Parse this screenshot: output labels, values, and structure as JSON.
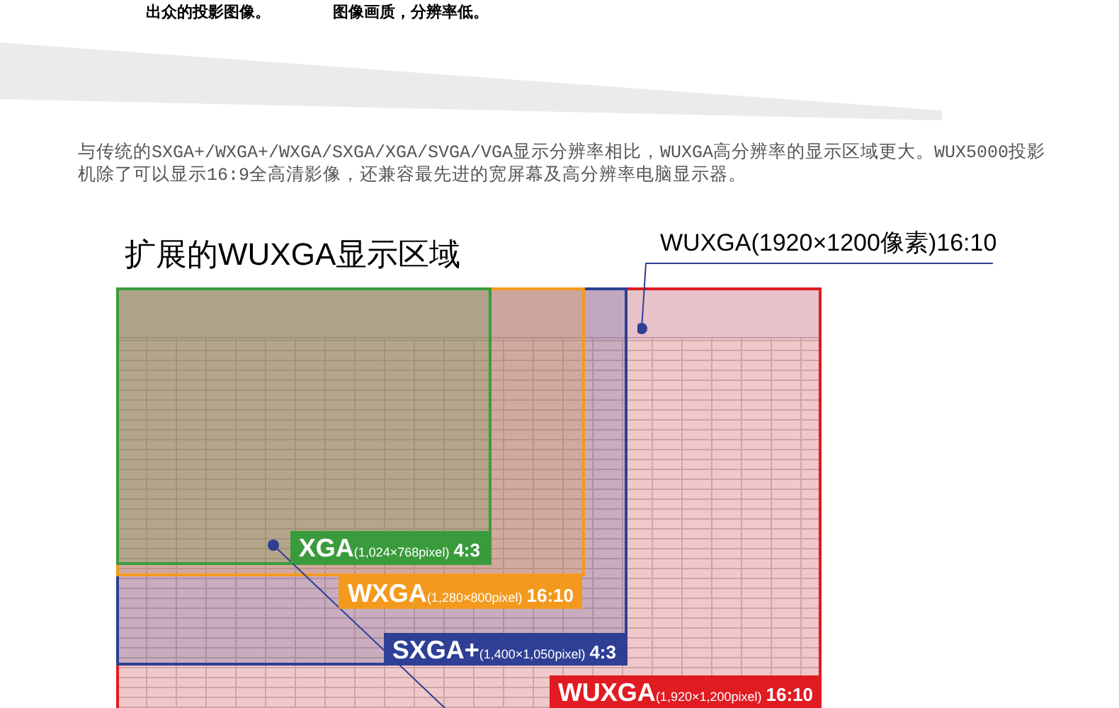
{
  "top_captions": [
    "出众的投影图像。",
    "图像画质，分辨率低。"
  ],
  "paragraph": "与传统的SXGA+/WXGA+/WXGA/SXGA/XGA/SVGA/VGA显示分辨率相比，WUXGA高分辨率的显示区域更大。WUX5000投影机除了可以显示16:9全高清影像，还兼容最先进的宽屏幕及高分辨率电脑显示器。",
  "title": "扩展的WUXGA显示区域",
  "callout": "WUXGA(1920×1200像素)16:10",
  "regions": [
    {
      "name": "WUXGA",
      "detail": "(1,920×1,200pixel)",
      "aspect": "16:10",
      "color": "#e01b22"
    },
    {
      "name": "SXGA+",
      "detail": "(1,400×1,050pixel)",
      "aspect": "4:3",
      "color": "#2e3f95"
    },
    {
      "name": "WXGA",
      "detail": "(1,280×800pixel)",
      "aspect": "16:10",
      "color": "#f39a1e"
    },
    {
      "name": "XGA",
      "detail": "(1,024×768pixel)",
      "aspect": "4:3",
      "color": "#3a9b3c"
    }
  ]
}
